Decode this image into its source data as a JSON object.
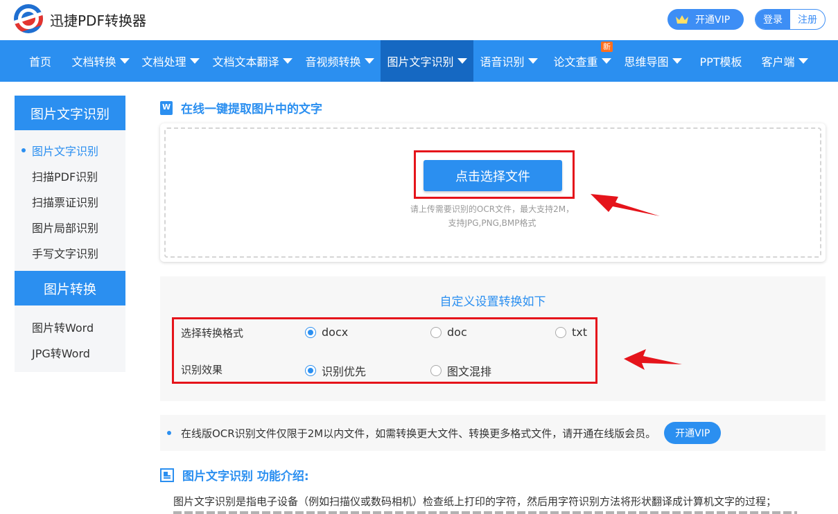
{
  "header": {
    "brand": "迅捷PDF转换器",
    "vip_label": "开通VIP",
    "login": "登录",
    "register": "注册"
  },
  "nav": {
    "items": [
      {
        "label": "首页",
        "dropdown": false
      },
      {
        "label": "文档转换",
        "dropdown": true
      },
      {
        "label": "文档处理",
        "dropdown": true
      },
      {
        "label": "文档文本翻译",
        "dropdown": true
      },
      {
        "label": "音视频转换",
        "dropdown": true
      },
      {
        "label": "图片文字识别",
        "dropdown": true,
        "active": true
      },
      {
        "label": "语音识别",
        "dropdown": true
      },
      {
        "label": "论文查重",
        "dropdown": true,
        "badge": "新"
      },
      {
        "label": "思维导图",
        "dropdown": true
      },
      {
        "label": "PPT模板",
        "dropdown": false
      },
      {
        "label": "客户端",
        "dropdown": true
      }
    ]
  },
  "sidebar": {
    "group1_title": "图片文字识别",
    "group1_items": [
      "图片文字识别",
      "扫描PDF识别",
      "扫描票证识别",
      "图片局部识别",
      "手写文字识别"
    ],
    "group2_title": "图片转换",
    "group2_items": [
      "图片转Word",
      "JPG转Word"
    ]
  },
  "main": {
    "section_title": "在线一键提取图片中的文字",
    "choose_file": "点击选择文件",
    "hint_line1": "请上传需要识别的OCR文件，最大支持2M，",
    "hint_line2": "支持JPG,PNG,BMP格式"
  },
  "settings": {
    "title": "自定义设置转换如下",
    "format_label": "选择转换格式",
    "format_options": [
      "docx",
      "doc",
      "txt"
    ],
    "format_selected": "docx",
    "effect_label": "识别效果",
    "effect_options": [
      "识别优先",
      "图文混排"
    ],
    "effect_selected": "识别优先"
  },
  "notice": {
    "text": "在线版OCR识别文件仅限于2M以内文件，如需转换更大文件、转换更多格式文件，请开通在线版会员。",
    "vip_label": "开通VIP"
  },
  "intro": {
    "title": "图片文字识别 功能介绍:",
    "text": "图片文字识别是指电子设备（例如扫描仪或数码相机）检查纸上打印的字符，然后用字符识别方法将形状翻译成计算机文字的过程；"
  },
  "colors": {
    "primary": "#2b8ff0",
    "nav_active": "#1568c2",
    "highlight": "#e5141b"
  }
}
